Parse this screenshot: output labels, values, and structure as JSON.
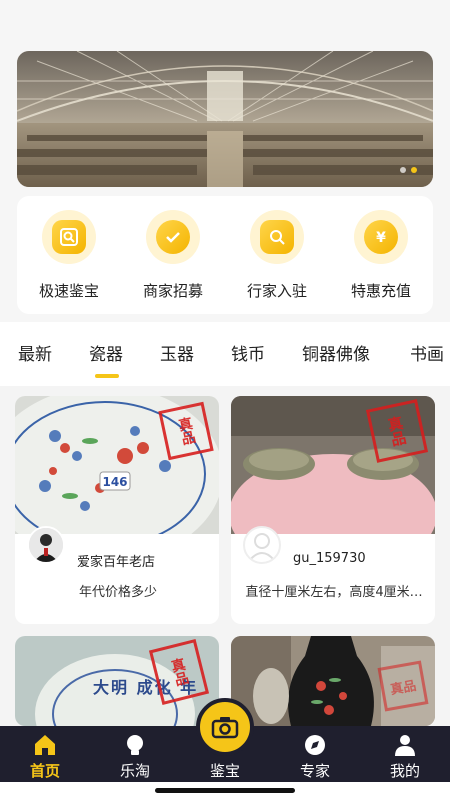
{
  "colors": {
    "accent": "#f5c518",
    "tabbar_bg": "#1f1f2e",
    "stamp_red": "#d61e1e"
  },
  "banner": {
    "dots": 2,
    "active_dot": 1
  },
  "quick_actions": [
    {
      "label": "极速鉴宝",
      "icon": "fast-appraisal-icon"
    },
    {
      "label": "商家招募",
      "icon": "merchant-recruit-icon"
    },
    {
      "label": "行家入驻",
      "icon": "expert-join-icon"
    },
    {
      "label": "特惠充值",
      "icon": "discount-recharge-icon"
    }
  ],
  "category_tabs": [
    {
      "label": "最新"
    },
    {
      "label": "瓷器",
      "active": true
    },
    {
      "label": "玉器"
    },
    {
      "label": "钱币"
    },
    {
      "label": "铜器佛像"
    },
    {
      "label": "书画"
    }
  ],
  "posts": [
    {
      "user": "爱家百年老店",
      "desc": "年代价格多少",
      "tag_number": "146",
      "stamp": "真品"
    },
    {
      "user": "gu_159730",
      "desc": "直径十厘米左右，高度4厘米…",
      "stamp": "真品"
    },
    {
      "stamp": "真品",
      "inscription": "大明 成化 年"
    },
    {
      "stamp": "真品"
    }
  ],
  "tabbar": [
    {
      "label": "首页",
      "icon": "home-icon",
      "active": true
    },
    {
      "label": "乐淘",
      "icon": "lightbulb-icon"
    },
    {
      "label": "鉴宝",
      "icon": "camera-icon"
    },
    {
      "label": "专家",
      "icon": "compass-icon"
    },
    {
      "label": "我的",
      "icon": "user-icon"
    }
  ]
}
